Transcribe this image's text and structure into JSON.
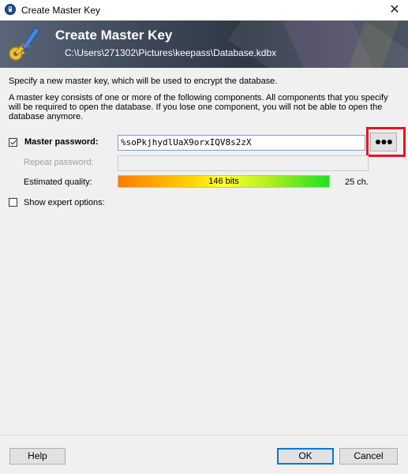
{
  "window": {
    "title": "Create Master Key",
    "close_glyph": "✕",
    "icon": "keepass-lock-icon"
  },
  "banner": {
    "title": "Create Master Key",
    "subtitle": "C:\\Users\\271302\\Pictures\\keepass\\Database.kdbx",
    "icon": "key-pen-icon"
  },
  "intro": {
    "line1": "Specify a new master key, which will be used to encrypt the database.",
    "line2": "A master key consists of one or more of the following components. All components that you specify will be required to open the database. If you lose one component, you will not be able to open the database anymore."
  },
  "master_password": {
    "checked": true,
    "label": "Master password:",
    "value": "%soPkjhydlUaX9orxIQV8s2zX",
    "reveal_button_label": "●●●"
  },
  "repeat_password": {
    "label": "Repeat password:",
    "value": ""
  },
  "quality": {
    "label": "Estimated quality:",
    "bar_text": "146 bits",
    "fill_fraction": 1.0,
    "char_count": "25 ch."
  },
  "expert": {
    "checked": false,
    "label": "Show expert options:"
  },
  "footer": {
    "help_label": "Help",
    "ok_label": "OK",
    "cancel_label": "Cancel"
  },
  "colors": {
    "highlight_box": "#e81123",
    "banner_dark": "#303846"
  }
}
